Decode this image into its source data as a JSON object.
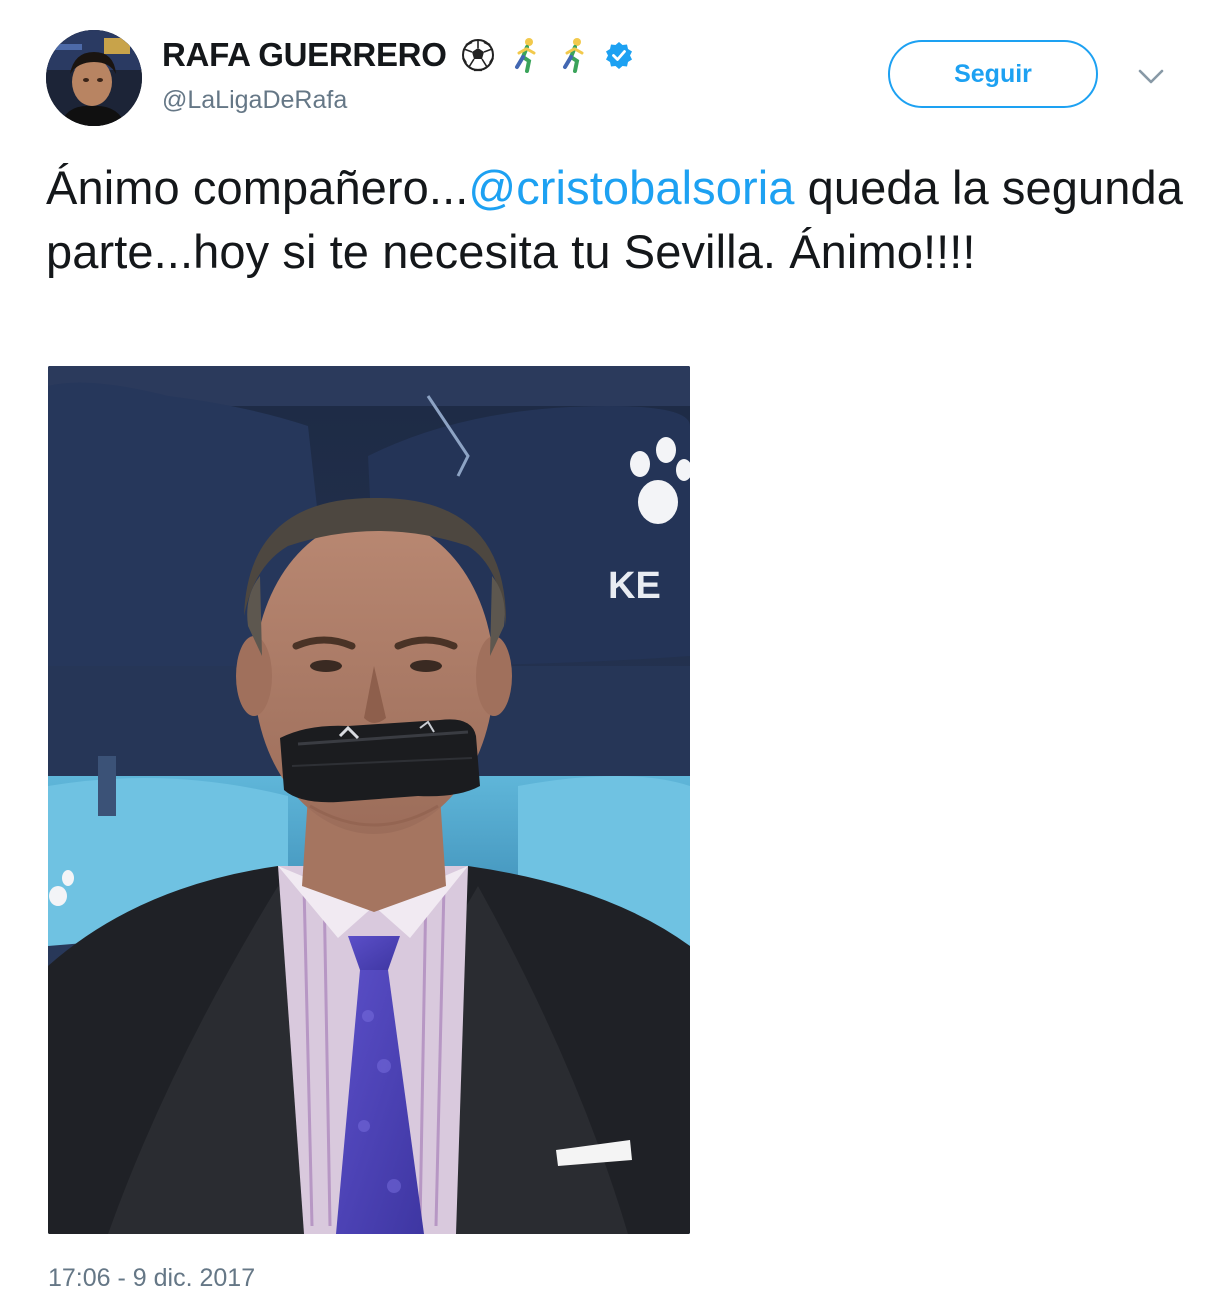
{
  "author": {
    "display_name": "RAFA GUERRERO",
    "name_emojis": [
      "soccer-ball-icon",
      "runner-icon",
      "runner-icon"
    ],
    "verified": true,
    "handle": "@LaLigaDeRafa"
  },
  "actions": {
    "follow_label": "Seguir"
  },
  "tweet": {
    "text_before": "Ánimo compañero...",
    "mention": "@cristobalsoria",
    "text_after": " queda la segunda parte...hoy si te necesita tu Sevilla. Ánimo!!!!",
    "media_logo_text": "KE",
    "timestamp": "17:06 - 9 dic. 2017"
  },
  "colors": {
    "accent": "#1da1f2",
    "text": "#14171a",
    "secondary": "#657786"
  }
}
